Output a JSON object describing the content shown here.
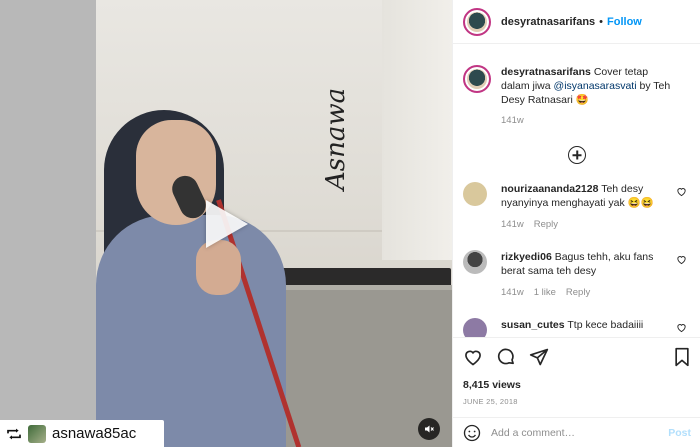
{
  "post": {
    "username": "desyratnasarifans",
    "follow_label": "Follow",
    "separator": "•"
  },
  "media": {
    "watermark": "Asnawa",
    "repost_username": "asnawa85ac",
    "icons": {
      "play": "play-icon",
      "mute": "mute-icon",
      "repost": "repost-icon"
    }
  },
  "caption": {
    "username": "desyratnasarifans",
    "text_before": "Cover tetap dalam jiwa ",
    "mention": "@isyanasarasvati",
    "text_after": " by Teh Desy Ratnasari 🤩",
    "time": "141w"
  },
  "comments": [
    {
      "username": "nourizaananda2128",
      "text": "Teh desy nyanyinya menghayati yak 😆😆",
      "time": "141w",
      "likes": "",
      "reply": "Reply"
    },
    {
      "username": "rizkyedi06",
      "text": "Bagus tehh, aku fans berat sama teh desy",
      "time": "141w",
      "likes": "1 like",
      "reply": "Reply"
    },
    {
      "username": "susan_cutes",
      "text": "Ttp kece badaiiii",
      "time": "",
      "likes": "",
      "reply": ""
    }
  ],
  "actions": {
    "views": "8,415 views",
    "date": "JUNE 25, 2018",
    "icons": [
      "heart-icon",
      "comment-icon",
      "share-icon",
      "bookmark-icon"
    ]
  },
  "add_comment": {
    "placeholder": "Add a comment…",
    "post_label": "Post",
    "icon": "emoji-icon"
  },
  "colors": {
    "link": "#0095f6",
    "mention": "#00376b",
    "muted": "#8e8e8e"
  }
}
